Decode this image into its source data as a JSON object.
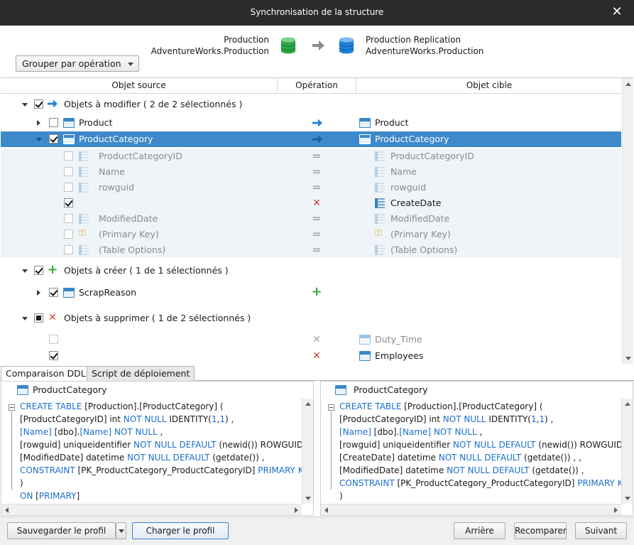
{
  "window": {
    "title": "Synchronisation de la structure",
    "close_glyph": "✕"
  },
  "header": {
    "group_by": "Grouper par opération",
    "source": {
      "line1": "Production",
      "line2": "AdventureWorks.Production",
      "db_color": "#2aa646"
    },
    "target": {
      "line1": "Production Replication",
      "line2": "AdventureWorks.Production",
      "db_color": "#1e7fd8"
    }
  },
  "grid": {
    "columns": [
      "Objet source",
      "Opération",
      "Objet cible"
    ],
    "groups": {
      "modify": {
        "label": "Objets à modifier ( 2 de 2 sélectionnés )",
        "icon": "arrow-right-icon"
      },
      "create": {
        "label": "Objets à créer ( 1 de 1 sélectionnés )",
        "icon": "plus-icon"
      },
      "delete": {
        "label": "Objets à supprimer ( 1 de 2 sélectionnés )",
        "icon": "x-icon"
      }
    },
    "rows": {
      "product": {
        "source": "Product",
        "target": "Product"
      },
      "productcategory": {
        "source": "ProductCategory",
        "target": "ProductCategory"
      },
      "c1": {
        "source": "ProductCategoryID",
        "target": "ProductCategoryID"
      },
      "c2": {
        "source": "Name",
        "target": "Name"
      },
      "c3": {
        "source": "rowguid",
        "target": "rowguid"
      },
      "c4": {
        "source": "",
        "target": "CreateDate"
      },
      "c5": {
        "source": "ModifiedDate",
        "target": "ModifiedDate"
      },
      "c6": {
        "source": "(Primary Key)",
        "target": "(Primary Key)"
      },
      "c7": {
        "source": "(Table Options)",
        "target": "(Table Options)"
      },
      "scrapreason": {
        "source": "ScrapReason",
        "target": ""
      },
      "dutytime": {
        "source": "",
        "target": "Duty_Time"
      },
      "employees": {
        "source": "",
        "target": "Employees"
      }
    },
    "selection_color": "#3d89c9"
  },
  "tabs": [
    "Comparaison DDL",
    "Script de déploiement"
  ],
  "ddl": {
    "left": {
      "title": "ProductCategory",
      "lines": [
        [
          [
            "kw",
            "CREATE TABLE"
          ],
          [
            "t",
            " [Production].[ProductCategory] ("
          ]
        ],
        [
          [
            "t",
            "[ProductCategoryID] int "
          ],
          [
            "kw",
            "NOT NULL"
          ],
          [
            "t",
            " IDENTITY("
          ],
          [
            "kw",
            "1"
          ],
          [
            "t",
            ","
          ],
          [
            "kw",
            "1"
          ],
          [
            "t",
            ") ,"
          ]
        ],
        [
          [
            "kw",
            "[Name]"
          ],
          [
            "t",
            " [dbo]."
          ],
          [
            "kw",
            "[Name]"
          ],
          [
            "t",
            " "
          ],
          [
            "kw",
            "NOT NULL"
          ],
          [
            "t",
            " ,"
          ]
        ],
        [
          [
            "t",
            "[rowguid] uniqueidentifier "
          ],
          [
            "kw",
            "NOT NULL DEFAULT"
          ],
          [
            "t",
            " (newid()) ROWGUIDCOL"
          ]
        ],
        [
          [
            "t",
            "[ModifiedDate] datetime "
          ],
          [
            "kw",
            "NOT NULL DEFAULT"
          ],
          [
            "t",
            " (getdate()) ,"
          ]
        ],
        [
          [
            "kw",
            "CONSTRAINT"
          ],
          [
            "t",
            " [PK_ProductCategory_ProductCategoryID] "
          ],
          [
            "kw",
            "PRIMARY KEY"
          ],
          [
            "t",
            " ("
          ]
        ],
        [
          [
            "t",
            ")"
          ]
        ],
        [
          [
            "kw",
            "ON"
          ],
          [
            "t",
            " ["
          ],
          [
            "kw",
            "PRIMARY"
          ],
          [
            "t",
            "]"
          ]
        ]
      ]
    },
    "right": {
      "title": "ProductCategory",
      "lines": [
        [
          [
            "kw",
            "CREATE TABLE"
          ],
          [
            "t",
            " [Production].[ProductCategory] ("
          ]
        ],
        [
          [
            "t",
            "[ProductCategoryID] int "
          ],
          [
            "kw",
            "NOT NULL"
          ],
          [
            "t",
            " IDENTITY("
          ],
          [
            "kw",
            "1"
          ],
          [
            "t",
            ","
          ],
          [
            "kw",
            "1"
          ],
          [
            "t",
            ") ,"
          ]
        ],
        [
          [
            "kw",
            "[Name]"
          ],
          [
            "t",
            " [dbo]."
          ],
          [
            "kw",
            "[Name]"
          ],
          [
            "t",
            " "
          ],
          [
            "kw",
            "NOT NULL"
          ],
          [
            "t",
            " ,"
          ]
        ],
        [
          [
            "t",
            "[rowguid] uniqueidentifier "
          ],
          [
            "kw",
            "NOT NULL DEFAULT"
          ],
          [
            "t",
            " (newid()) ROWGUIDCOL"
          ]
        ],
        [
          [
            "t",
            "[CreateDate] datetime "
          ],
          [
            "kw",
            "NOT NULL DEFAULT"
          ],
          [
            "t",
            " (getdate()) , ,"
          ]
        ],
        [
          [
            "t",
            "[ModifiedDate] datetime "
          ],
          [
            "kw",
            "NOT NULL DEFAULT"
          ],
          [
            "t",
            " (getdate()) ,"
          ]
        ],
        [
          [
            "kw",
            "CONSTRAINT"
          ],
          [
            "t",
            " [PK_ProductCategory_ProductCategoryID] "
          ],
          [
            "kw",
            "PRIMARY KEY"
          ]
        ],
        [
          [
            "t",
            ")"
          ]
        ]
      ]
    }
  },
  "footer": {
    "save_profile": "Sauvegarder le profil",
    "load_profile": "Charger le profil",
    "back": "Arrière",
    "recompare": "Recomparer",
    "next": "Suivant"
  }
}
